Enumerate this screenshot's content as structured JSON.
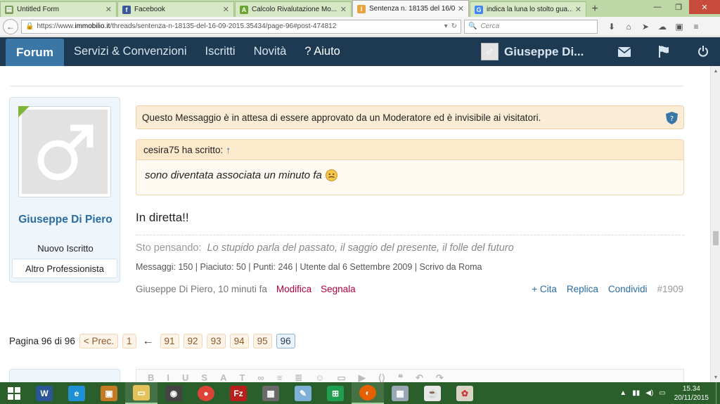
{
  "browser": {
    "tabs": [
      {
        "title": "Untitled Form",
        "favicon": "form-icon",
        "color": "#bdd7a6"
      },
      {
        "title": "Facebook",
        "favicon": "facebook-icon",
        "color": "#3b5998"
      },
      {
        "title": "Calcolo Rivalutazione Mo...",
        "favicon": "calc-icon",
        "color": "#6aa42f"
      },
      {
        "title": "Sentenza n. 18135 del 16/0...",
        "favicon": "immobilio-icon",
        "color": "#e8a33d",
        "active": true
      },
      {
        "title": "indica la luna lo stolto gua...",
        "favicon": "google-icon",
        "color": "#4285f4"
      }
    ],
    "url_prefix": "https://www.",
    "url_domain": "immobilio.it",
    "url_rest": "/threads/sentenza-n-18135-del-16-09-2015.35434/page-96#post-474812",
    "search_placeholder": "Cerca"
  },
  "forum": {
    "tab_forum": "Forum",
    "menu": [
      "Servizi & Convenzioni",
      "Iscritti",
      "Novità",
      "? Aiuto"
    ],
    "username": "Giuseppe Di...",
    "icons": [
      "envelope-icon",
      "flag-icon",
      "power-icon"
    ],
    "colors": {
      "header": "#1e3a52",
      "active_tab": "#3a77a6",
      "link": "#2a6ca0"
    }
  },
  "post": {
    "author_name": "Giuseppe Di Piero",
    "author_rank": "Nuovo Iscritto",
    "author_profession": "Altro Professionista",
    "mod_notice": "Questo Messaggio è in attesa di essere approvato da un Moderatore ed è invisibile ai visitatori.",
    "quote_author": "cesira75 ha scritto:",
    "quote_arrow": "↑",
    "quote_text": "sono diventata associata un minuto fa",
    "message": "In diretta!!",
    "sig_label": "Sto pensando:",
    "sig_text": "Lo stupido parla del passato, il saggio del presente, il folle del futuro",
    "stats": "Messaggi: 150 | Piaciuto: 50 | Punti: 246 | Utente dal 6 Settembre 2009 | Scrivo da Roma",
    "meta_author": "Giuseppe Di Piero",
    "meta_time": ", 10 minuti fa",
    "edit_link": "Modifica",
    "report_link": "Segnala",
    "actions": {
      "quote": "+ Cita",
      "reply": "Replica",
      "share": "Condividi",
      "number": "#1909"
    }
  },
  "pagination": {
    "label": "Pagina 96 di 96",
    "prev": "< Prec.",
    "first": "1",
    "arrow": "←",
    "pages": [
      "91",
      "92",
      "93",
      "94",
      "95"
    ],
    "current": "96"
  },
  "taskbar": {
    "time": "15.34",
    "date": "20/11/2015"
  }
}
